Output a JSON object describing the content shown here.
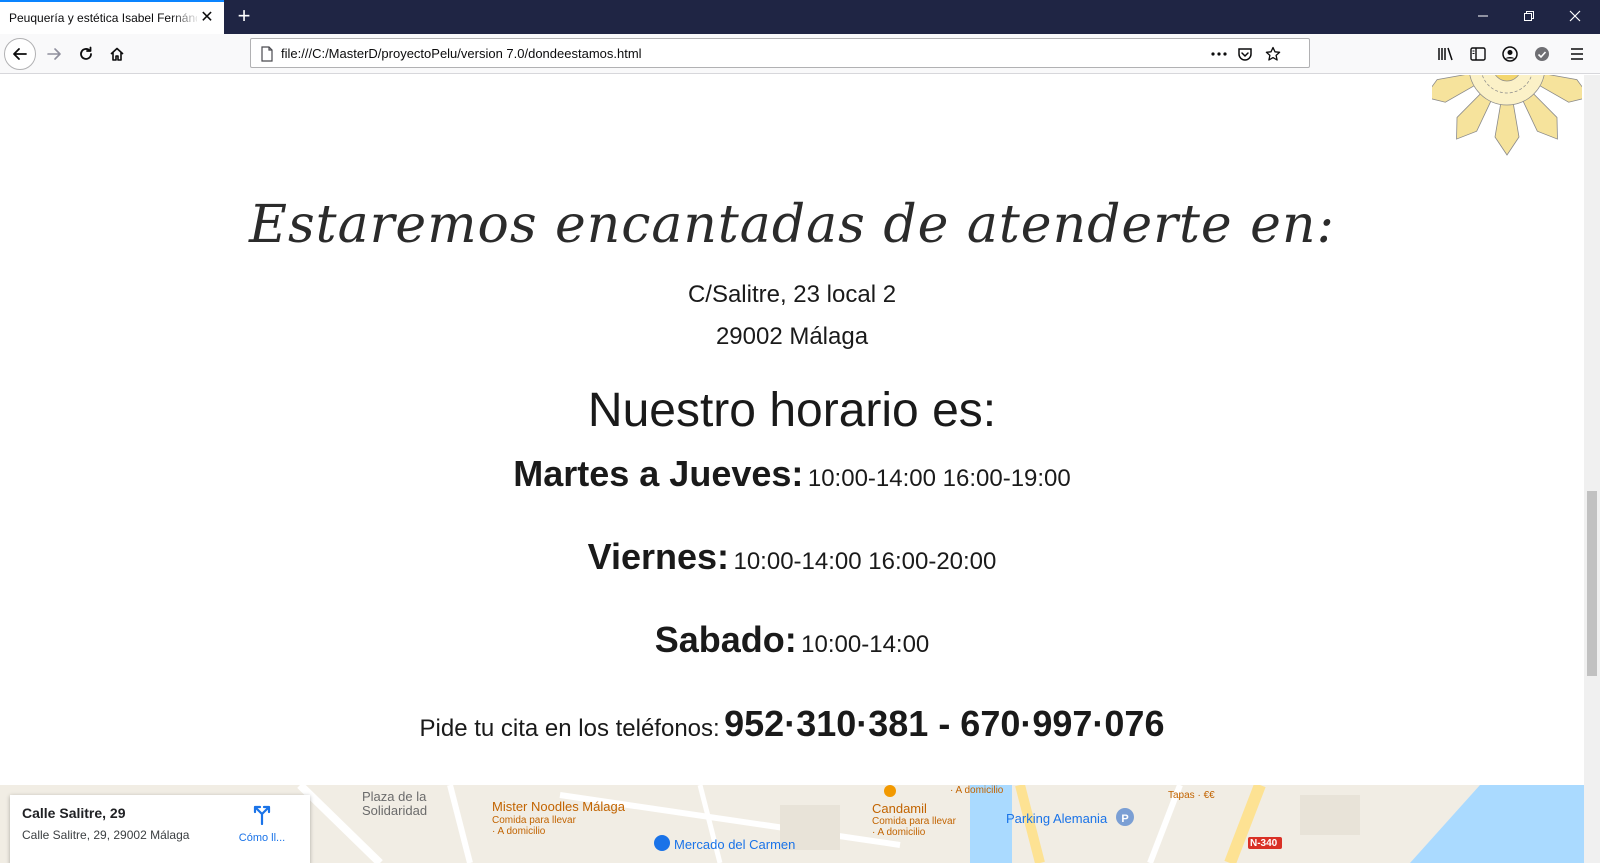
{
  "browser": {
    "tab_title": "Peuquería y estética Isabel Fernández",
    "url": "file:///C:/MasterD/proyectoPelu/version 7.0/dondeestamos.html"
  },
  "page": {
    "welcome_heading": "Estaremos encantadas de atenderte en:",
    "address_line1": "C/Salitre, 23 local 2",
    "address_line2": "29002 Málaga",
    "schedule_heading": "Nuestro horario es:",
    "schedule": [
      {
        "day": "Martes a Jueves:",
        "hours": "10:00-14:00 16:00-19:00"
      },
      {
        "day": "Viernes:",
        "hours": "10:00-14:00 16:00-20:00"
      },
      {
        "day": "Sabado:",
        "hours": "10:00-14:00"
      }
    ],
    "phone_label": "Pide tu cita en los teléfonos:",
    "phone_numbers": "952·310·381 - 670·997·076"
  },
  "map": {
    "card_title": "Calle Salitre, 29",
    "card_address": "Calle Salitre, 29, 29002 Málaga",
    "directions_label": "Cómo ll...",
    "places": [
      {
        "name": "Plaza de la",
        "color": "#6b6b6b"
      },
      {
        "name": "Solidaridad",
        "color": "#6b6b6b"
      },
      {
        "name": "Mister Noodles Málaga",
        "color": "#c26401"
      },
      {
        "name": "Comida para llevar",
        "color": "#c26401"
      },
      {
        "name": "· A domicilio",
        "color": "#c26401"
      },
      {
        "name": "Mercado del Carmen",
        "color": "#1a73e8"
      },
      {
        "name": "Candamil",
        "color": "#c26401"
      },
      {
        "name": "Comida para llevar",
        "color": "#c26401"
      },
      {
        "name": "· A domicilio",
        "color": "#c26401"
      },
      {
        "name": "· A domicilio",
        "color": "#c26401"
      },
      {
        "name": "Parking Alemania",
        "color": "#1a73e8"
      },
      {
        "name": "Tapas · €€",
        "color": "#c26401"
      },
      {
        "name": "N-340",
        "color": "#ffffff"
      }
    ]
  }
}
